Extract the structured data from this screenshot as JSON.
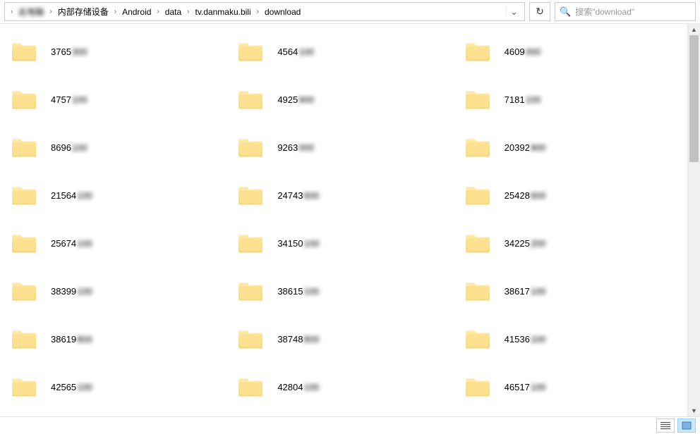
{
  "breadcrumb": {
    "hidden_prefix": "此电脑",
    "items": [
      "内部存储设备",
      "Android",
      "data",
      "tv.danmaku.bili",
      "download"
    ]
  },
  "search": {
    "placeholder": "搜索\"download\""
  },
  "folders": [
    {
      "visible": "3765",
      "suffix": "3"
    },
    {
      "visible": "4564",
      "suffix": "1"
    },
    {
      "visible": "4609",
      "suffix": "0"
    },
    {
      "visible": "4757",
      "suffix": "1"
    },
    {
      "visible": "4925",
      "suffix": "9"
    },
    {
      "visible": "7181",
      "suffix": "1"
    },
    {
      "visible": "8696",
      "suffix": "1"
    },
    {
      "visible": "9263",
      "suffix": "0"
    },
    {
      "visible": "20392",
      "suffix": "9"
    },
    {
      "visible": "21564",
      "suffix": "1"
    },
    {
      "visible": "24743",
      "suffix": "6"
    },
    {
      "visible": "25428",
      "suffix": "6"
    },
    {
      "visible": "25674",
      "suffix": "1"
    },
    {
      "visible": "34150",
      "suffix": "1"
    },
    {
      "visible": "34225",
      "suffix": "2"
    },
    {
      "visible": "38399",
      "suffix": "1"
    },
    {
      "visible": "38615",
      "suffix": "1"
    },
    {
      "visible": "38617",
      "suffix": "1"
    },
    {
      "visible": "38619",
      "suffix": "8"
    },
    {
      "visible": "38748",
      "suffix": "8"
    },
    {
      "visible": "41536",
      "suffix": "1"
    },
    {
      "visible": "42565",
      "suffix": "1"
    },
    {
      "visible": "42804",
      "suffix": "1"
    },
    {
      "visible": "46517",
      "suffix": "1"
    }
  ]
}
